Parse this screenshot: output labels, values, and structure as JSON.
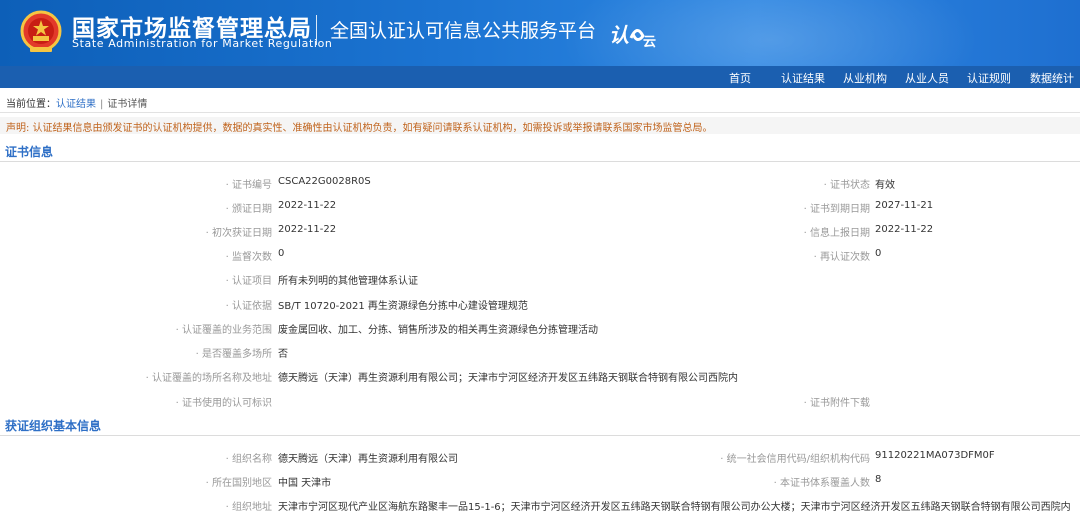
{
  "header": {
    "org_name_cn": "国家市场监督管理总局",
    "org_name_en": "State Administration for Market Regulation",
    "platform_title": "全国认证认可信息公共服务平台",
    "logo_text": "认e云",
    "emblem_icon": "national-emblem-icon",
    "colors": {
      "banner": "#1b73d1",
      "nav": "#1b5fb0"
    }
  },
  "nav": {
    "items": [
      "首页",
      "认证结果",
      "从业机构",
      "从业人员",
      "认证规则",
      "数据统计"
    ]
  },
  "breadcrumb": {
    "prefix": "当前位置：",
    "items": [
      "认证结果",
      "证书详情"
    ],
    "separator": "|"
  },
  "notice": "声明: 认证结果信息由颁发证书的认证机构提供，数据的真实性、准确性由认证机构负责，如有疑问请联系认证机构，如需投诉或举报请联系国家市场监管总局。",
  "certificate": {
    "title": "证书信息",
    "rows": [
      {
        "label": "证书编号",
        "value": "CSCA22G0028R0S",
        "label2": "证书状态",
        "value2": "有效"
      },
      {
        "label": "颁证日期",
        "value": "2022-11-22",
        "label2": "证书到期日期",
        "value2": "2027-11-21"
      },
      {
        "label": "初次获证日期",
        "value": "2022-11-22",
        "label2": "信息上报日期",
        "value2": "2022-11-22"
      },
      {
        "label": "监督次数",
        "value": "0",
        "label2": "再认证次数",
        "value2": "0"
      },
      {
        "label": "认证项目",
        "value": "所有未列明的其他管理体系认证"
      },
      {
        "label": "认证依据",
        "value": "SB/T 10720-2021 再生资源绿色分拣中心建设管理规范"
      },
      {
        "label": "认证覆盖的业务范围",
        "value": "废金属回收、加工、分拣、销售所涉及的相关再生资源绿色分拣管理活动"
      },
      {
        "label": "是否覆盖多场所",
        "value": "否"
      },
      {
        "label": "认证覆盖的场所名称及地址",
        "value": "德天腾远（天津）再生资源利用有限公司；天津市宁河区经济开发区五纬路天钢联合特钢有限公司西院内"
      },
      {
        "label": "证书使用的认可标识",
        "value": "",
        "label2": "证书附件下载",
        "value2": ""
      }
    ]
  },
  "organization": {
    "title": "获证组织基本信息",
    "rows": [
      {
        "label": "组织名称",
        "value": "德天腾远（天津）再生资源利用有限公司",
        "label2": "统一社会信用代码/组织机构代码",
        "value2": "91120221MA073DFM0F"
      },
      {
        "label": "所在国别地区",
        "value": "中国 天津市",
        "label2": "本证书体系覆盖人数",
        "value2": "8"
      },
      {
        "label": "组织地址",
        "value": "天津市宁河区现代产业区海航东路聚丰一品15-1-6；天津市宁河区经济开发区五纬路天钢联合特钢有限公司办公大楼；天津市宁河区经济开发区五纬路天钢联合特钢有限公司西院内"
      }
    ]
  }
}
